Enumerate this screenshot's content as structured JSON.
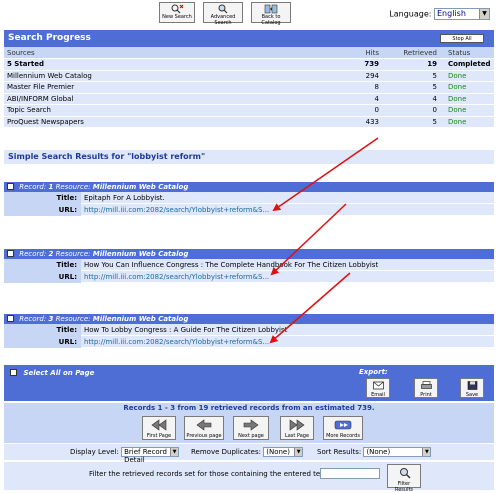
{
  "toolbar": {
    "new_search": "New Search",
    "advanced_search": "Advanced Search",
    "back_to_catalog": "Back to Catalog",
    "language_label": "Language:",
    "language_value": "English"
  },
  "progress": {
    "title": "Search Progress",
    "stop_all": "Stop All",
    "columns": [
      "Sources",
      "Hits",
      "Retrieved",
      "Status"
    ],
    "rows": [
      {
        "source": "5 Started",
        "hits": "739",
        "retrieved": "19",
        "status": "Completed"
      },
      {
        "source": "Millennium Web Catalog",
        "hits": "294",
        "retrieved": "5",
        "status": "Done"
      },
      {
        "source": "Master File Premier",
        "hits": "8",
        "retrieved": "5",
        "status": "Done"
      },
      {
        "source": "ABI/INFORM Global",
        "hits": "4",
        "retrieved": "4",
        "status": "Done"
      },
      {
        "source": "Topic Search",
        "hits": "0",
        "retrieved": "0",
        "status": "Done"
      },
      {
        "source": "ProQuest Newspapers",
        "hits": "433",
        "retrieved": "5",
        "status": "Done"
      }
    ]
  },
  "results": {
    "title": "Simple Search Results for \"lobbyist reform\"",
    "record_word": "Record:",
    "resource_word": "Resource:",
    "title_label": "Title:",
    "url_label": "URL:",
    "records": [
      {
        "num": "1",
        "resource": "Millennium Web Catalog",
        "title": "Epitaph For A Lobbyist.",
        "url": "http://mill.iii.com:2082/search/Ylobbyist+reform&S..."
      },
      {
        "num": "2",
        "resource": "Millennium Web Catalog",
        "title": "How You Can Influence Congress : The Complete Handbook For The Citizen Lobbyist",
        "url": "http://mill.iii.com:2082/search/Ylobbyist+reform&S..."
      },
      {
        "num": "3",
        "resource": "Millennium Web Catalog",
        "title": "How To Lobby Congress : A Guide For The Citizen Lobbyist",
        "url": "http://mill.iii.com:2082/search/Ylobbyist+reform&S..."
      }
    ]
  },
  "actions": {
    "select_all": "Select All on Page",
    "export": "Export:",
    "email": "Email",
    "print": "Print",
    "save": "Save"
  },
  "nav": {
    "records_summary": "Records 1 - 3 from 19 retrieved records from an estimated 739.",
    "first_page": "First Page",
    "previous_page": "Previous page",
    "next_page": "Next page",
    "last_page": "Last Page",
    "more_records": "More Records"
  },
  "options": {
    "display_level_label": "Display Level:",
    "display_level_value": "Brief Record Detail",
    "remove_duplicates_label": "Remove Duplicates:",
    "remove_duplicates_value": "(None)",
    "sort_results_label": "Sort Results:",
    "sort_results_value": "(None)"
  },
  "filter": {
    "label": "Filter the retrieved records set for those containing the entered text:",
    "value": "",
    "button": "Filter Results"
  },
  "colors": {
    "header_blue": "#4e6ed6",
    "row_light": "#dfe7fb",
    "annotation_arrow": "#e01010",
    "done_green": "#1a8a1a"
  }
}
